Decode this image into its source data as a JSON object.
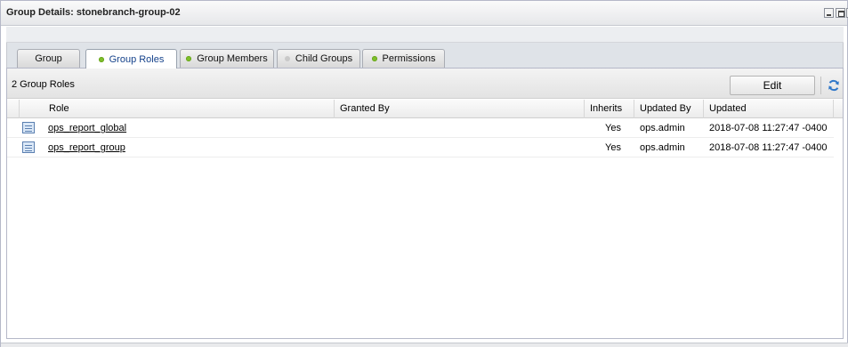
{
  "window": {
    "title": "Group Details: stonebranch-group-02"
  },
  "tabs": [
    {
      "label": "Group",
      "indicator": "none",
      "active": false
    },
    {
      "label": "Group Roles",
      "indicator": "green",
      "active": true
    },
    {
      "label": "Group Members",
      "indicator": "green",
      "active": false
    },
    {
      "label": "Child Groups",
      "indicator": "gray",
      "active": false
    },
    {
      "label": "Permissions",
      "indicator": "green",
      "active": false
    }
  ],
  "grid": {
    "count_label": "2 Group Roles",
    "edit_label": "Edit",
    "refresh_icon": "refresh-icon",
    "columns": [
      "Role",
      "Granted By",
      "Inherits",
      "Updated By",
      "Updated"
    ],
    "rows": [
      {
        "role": "ops_report_global",
        "granted_by": "",
        "inherits": "Yes",
        "updated_by": "ops.admin",
        "updated": "2018-07-08 11:27:47 -0400"
      },
      {
        "role": "ops_report_group",
        "granted_by": "",
        "inherits": "Yes",
        "updated_by": "ops.admin",
        "updated": "2018-07-08 11:27:47 -0400"
      }
    ]
  },
  "colors": {
    "active_tab_text": "#15428b",
    "indicator_green": "#7ec02a",
    "indicator_gray": "#c9c9c9",
    "refresh_blue": "#2f77c9"
  }
}
